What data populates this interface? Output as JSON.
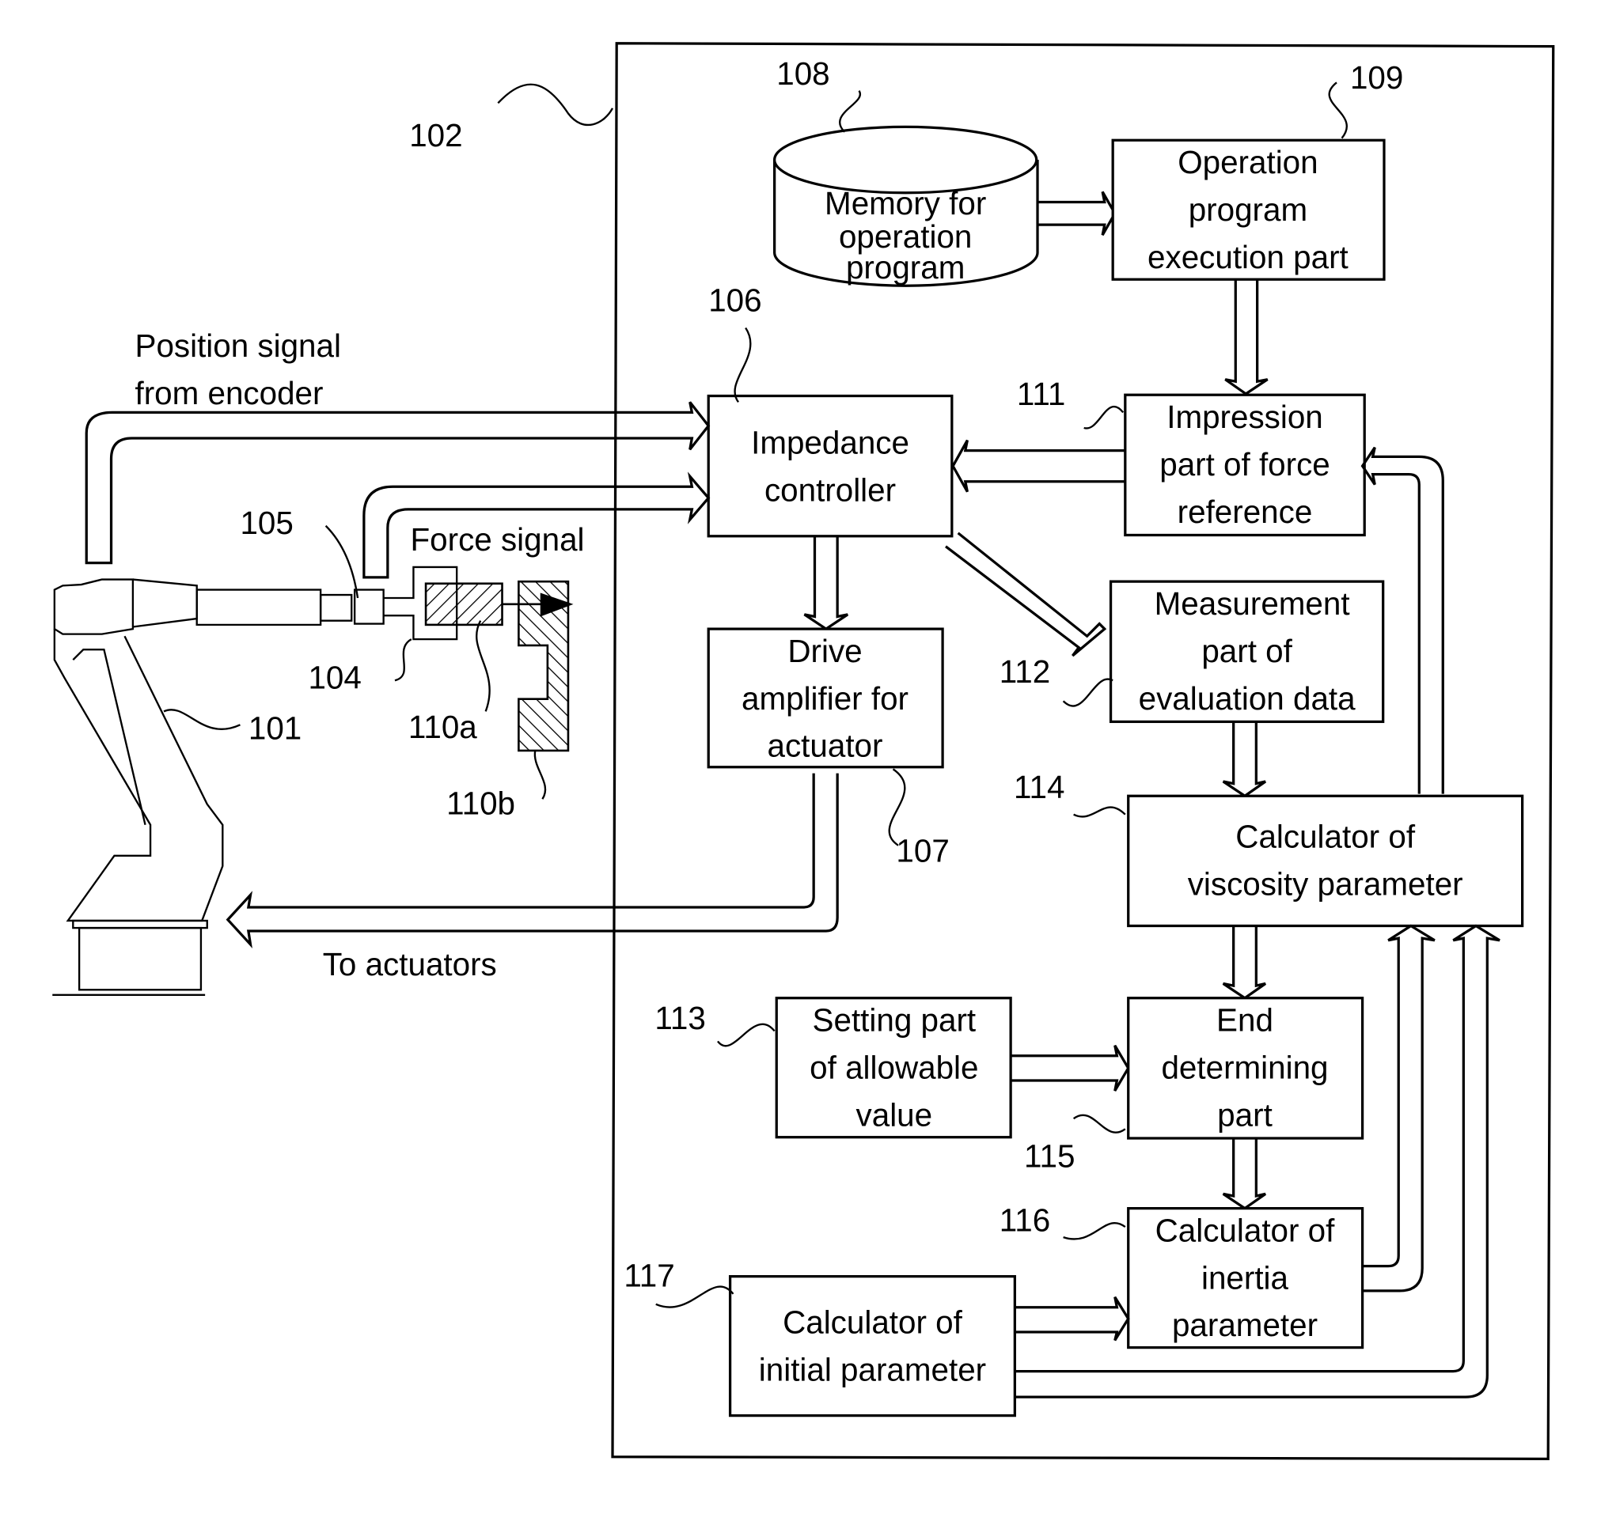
{
  "diagram": {
    "ref_labels": {
      "controller": "102",
      "memory": "108",
      "execution": "109",
      "impedance": "106",
      "impression": "111",
      "measurement": "112",
      "drive": "107",
      "viscosity": "114",
      "setting": "113",
      "end": "115",
      "inertia": "116",
      "initial": "117",
      "robot": "101",
      "sensor": "105",
      "hand": "104",
      "object_a": "110a",
      "object_b": "110b"
    },
    "blocks": {
      "memory": [
        "Memory for",
        "operation",
        "program"
      ],
      "execution": [
        "Operation",
        "program",
        "execution part"
      ],
      "impedance": [
        "Impedance",
        "controller"
      ],
      "impression": [
        "Impression",
        "part of force",
        "reference"
      ],
      "measurement": [
        "Measurement",
        "part of",
        "evaluation data"
      ],
      "drive": [
        "Drive",
        "amplifier for",
        "actuator"
      ],
      "viscosity": [
        "Calculator of",
        "viscosity parameter"
      ],
      "setting": [
        "Setting part",
        "of allowable",
        "value"
      ],
      "end": [
        "End",
        "determining",
        "part"
      ],
      "inertia": [
        "Calculator of",
        "inertia",
        "parameter"
      ],
      "initial": [
        "Calculator of",
        "initial parameter"
      ]
    },
    "signals": {
      "position": [
        "Position signal",
        "from encoder"
      ],
      "force": "Force signal",
      "actuators": "To actuators"
    }
  }
}
